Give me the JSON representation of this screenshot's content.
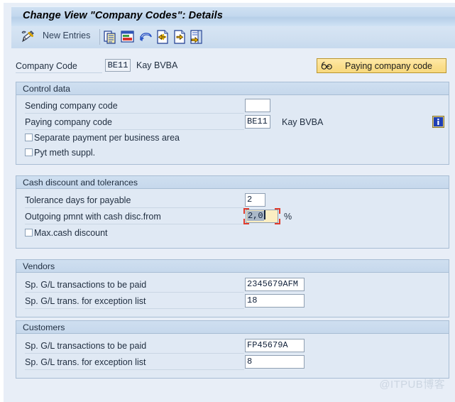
{
  "window": {
    "title": "Change View \"Company Codes\": Details"
  },
  "toolbar": {
    "pencil_icon": "pencil-display-change-icon",
    "new_entries_label": "New Entries",
    "icons": [
      {
        "name": "copy-icon",
        "title": "Copy As"
      },
      {
        "name": "copy-as-icon",
        "title": "Copy"
      },
      {
        "name": "undo-icon",
        "title": "Undo"
      },
      {
        "name": "previous-entry-icon",
        "title": "Previous Entry"
      },
      {
        "name": "next-entry-icon",
        "title": "Next Entry"
      },
      {
        "name": "last-entry-icon",
        "title": "Last Entry"
      }
    ]
  },
  "header": {
    "company_code_label": "Company Code",
    "company_code_value": "BE11",
    "company_name": "Kay BVBA",
    "paying_company_code_button": "Paying company code",
    "paying_button_icon": "glasses-icon"
  },
  "groups": [
    {
      "id": "control-data",
      "title": "Control data",
      "rows": [
        {
          "type": "input",
          "label": "Sending company code",
          "value": "",
          "placeholder": "",
          "input_width": 36,
          "trailing": ""
        },
        {
          "type": "input",
          "label": "Paying company code",
          "value": "BE11",
          "placeholder": "",
          "input_width": 36,
          "trailing": "Kay BVBA",
          "info_icon": "information-icon"
        },
        {
          "type": "checkbox",
          "label": "Separate payment per business area",
          "checked": false
        },
        {
          "type": "checkbox",
          "label": "Pyt meth suppl.",
          "checked": false
        }
      ]
    },
    {
      "id": "cash-discount-and-tolerances",
      "title": "Cash discount and tolerances",
      "rows": [
        {
          "type": "input",
          "label": "Tolerance days for payable",
          "value": "2",
          "placeholder": "",
          "input_width": 29,
          "trailing": ""
        },
        {
          "type": "input-focused",
          "label": "Outgoing pmnt with cash disc.from",
          "value": "2,0",
          "selected_text": "2,0",
          "placeholder": "",
          "input_width": 46,
          "trailing": "%"
        },
        {
          "type": "checkbox",
          "label": "Max.cash discount",
          "checked": false
        }
      ]
    },
    {
      "id": "vendors",
      "title": "Vendors",
      "rows": [
        {
          "type": "input",
          "label": "Sp. G/L transactions to be paid",
          "value": "2345679AFM",
          "placeholder": "",
          "input_width": 84,
          "trailing": ""
        },
        {
          "type": "input",
          "label": "Sp. G/L trans. for exception list",
          "value": "18",
          "placeholder": "",
          "input_width": 84,
          "trailing": ""
        }
      ]
    },
    {
      "id": "customers",
      "title": "Customers",
      "rows": [
        {
          "type": "input",
          "label": "Sp. G/L transactions to be paid",
          "value": "FP45679A",
          "placeholder": "",
          "input_width": 84,
          "trailing": ""
        },
        {
          "type": "input",
          "label": "Sp. G/L trans. for exception list",
          "value": "8",
          "placeholder": "",
          "input_width": 84,
          "trailing": ""
        }
      ]
    }
  ],
  "watermark": "@ITPUB博客",
  "colors": {
    "window_background": "#e8eef7",
    "title_bar": "#c3d8ee",
    "group_background": "#e0e9f4",
    "group_border": "#a8bdd4",
    "accent_button": "#fbdf8e",
    "focus_marker": "#e03b2c",
    "info_icon": "#1e3fb5"
  }
}
